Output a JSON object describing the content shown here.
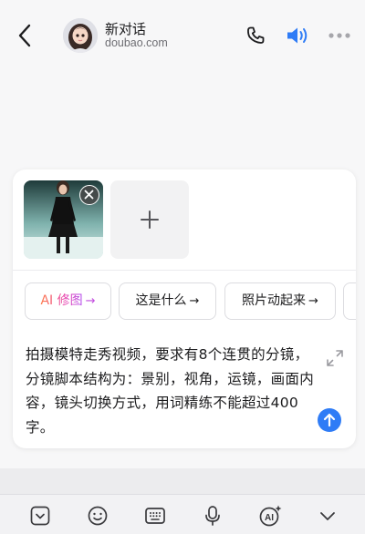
{
  "header": {
    "title": "新对话",
    "subtitle": "doubao.com"
  },
  "composer": {
    "chips": [
      {
        "label": "AI 修图",
        "arrow": "→",
        "style": "ai"
      },
      {
        "label": "这是什么",
        "arrow": "→",
        "style": "plain"
      },
      {
        "label": "照片动起来",
        "arrow": "→",
        "style": "plain"
      }
    ],
    "prompt_text": "拍摄模特走秀视频，要求有8个连贯的分镜，分镜脚本结构为：景别，视角，运镜，画面内容，镜头切换方式，用词精练不能超过400字。"
  },
  "colors": {
    "accent_blue": "#2f7cf6",
    "ai_gradient_start": "#ff7a45",
    "ai_gradient_end": "#b04cf0"
  },
  "icons": {
    "back": "chevron-left-icon",
    "phone": "phone-icon",
    "speaker": "speaker-icon",
    "more": "more-icon",
    "remove": "close-icon",
    "add": "plus-icon",
    "expand": "expand-icon",
    "send": "arrow-up-icon",
    "toolbar": [
      "collapse-icon",
      "emoji-icon",
      "keyboard-icon",
      "microphone-icon",
      "ai-icon",
      "chevron-down-icon"
    ]
  }
}
